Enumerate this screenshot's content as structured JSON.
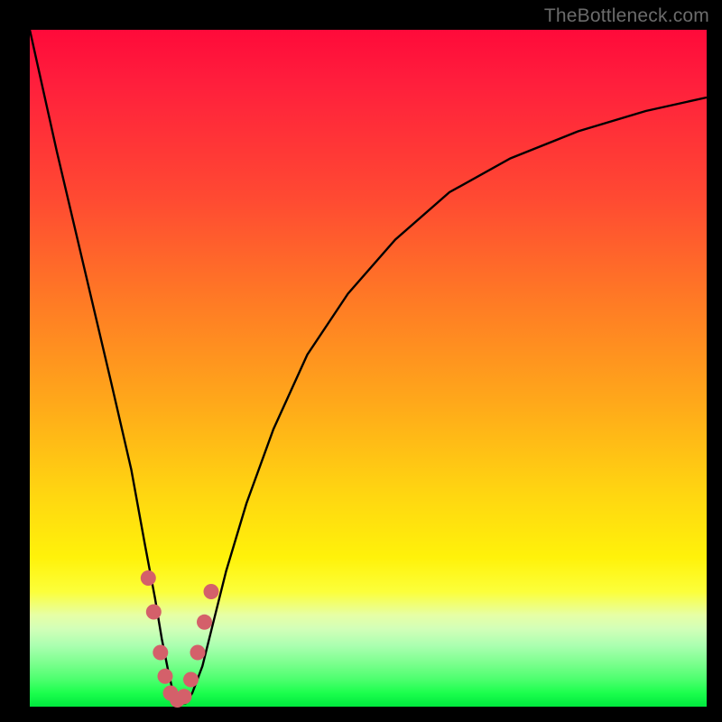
{
  "watermark": "TheBottleneck.com",
  "colors": {
    "frame": "#000000",
    "curve": "#000000",
    "marker_fill": "#d4606a",
    "marker_stroke": "#c24a55",
    "gradient_stops": [
      "#ff0a3a",
      "#ff7a25",
      "#ffd411",
      "#fcff3a",
      "#d2ffb8",
      "#00e83e"
    ]
  },
  "chart_data": {
    "type": "line",
    "title": "",
    "xlabel": "",
    "ylabel": "",
    "xlim": [
      0,
      100
    ],
    "ylim": [
      0,
      100
    ],
    "grid": false,
    "legend": false,
    "note": "V-shaped bottleneck curve; y is mismatch percentage (0 at bottom = no bottleneck, 100 at top). Values estimated from pixel positions — no axis ticks are shown in the source image.",
    "series": [
      {
        "name": "bottleneck-curve",
        "x": [
          0,
          4,
          8,
          12,
          15,
          17,
          18.5,
          19.5,
          20.5,
          21.2,
          22,
          23,
          24,
          25.5,
          27,
          29,
          32,
          36,
          41,
          47,
          54,
          62,
          71,
          81,
          91,
          100
        ],
        "y": [
          100,
          82,
          65,
          48,
          35,
          24,
          16,
          10,
          5,
          2,
          0.5,
          0.5,
          2,
          6,
          12,
          20,
          30,
          41,
          52,
          61,
          69,
          76,
          81,
          85,
          88,
          90
        ]
      }
    ],
    "markers": {
      "name": "highlighted-points",
      "note": "Pink dots clustered near the curve minimum",
      "points": [
        {
          "x": 17.5,
          "y": 19
        },
        {
          "x": 18.3,
          "y": 14
        },
        {
          "x": 19.3,
          "y": 8
        },
        {
          "x": 20.0,
          "y": 4.5
        },
        {
          "x": 20.8,
          "y": 2
        },
        {
          "x": 21.8,
          "y": 1
        },
        {
          "x": 22.8,
          "y": 1.5
        },
        {
          "x": 23.8,
          "y": 4
        },
        {
          "x": 24.8,
          "y": 8
        },
        {
          "x": 25.8,
          "y": 12.5
        },
        {
          "x": 26.8,
          "y": 17
        }
      ]
    }
  }
}
